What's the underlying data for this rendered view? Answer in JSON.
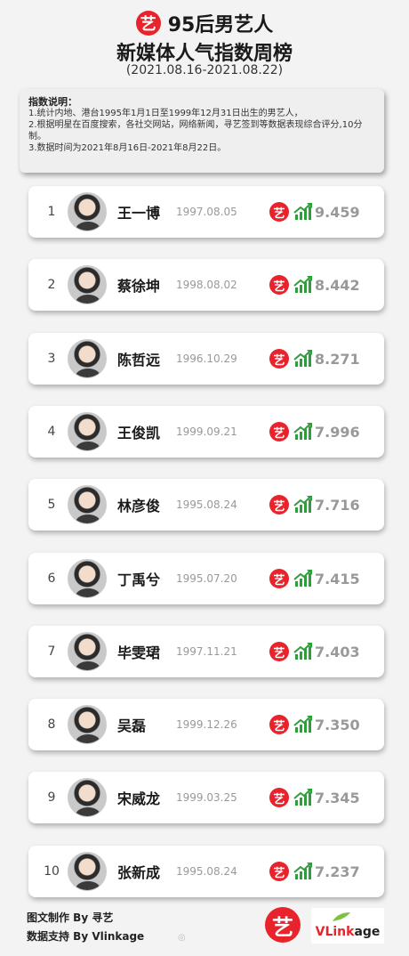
{
  "header": {
    "logo_char": "艺",
    "title1": "95后男艺人",
    "title2": "新媒体人气指数周榜",
    "date_range": "(2021.08.16-2021.08.22)"
  },
  "explanation": {
    "title": "指数说明：",
    "line1": "1.统计内地、港台1995年1月1日至1999年12月31日出生的男艺人，",
    "line2": "2.根据明星在百度搜索，各社交网站，网络新闻，寻艺签到等数据表现综合评分,10分制。",
    "line3": "3.数据时间为2021年8月16日-2021年8月22日。"
  },
  "rankings": [
    {
      "rank": "1",
      "name": "王一博",
      "birth": "1997.08.05",
      "score": "9.459"
    },
    {
      "rank": "2",
      "name": "蔡徐坤",
      "birth": "1998.08.02",
      "score": "8.442"
    },
    {
      "rank": "3",
      "name": "陈哲远",
      "birth": "1996.10.29",
      "score": "8.271"
    },
    {
      "rank": "4",
      "name": "王俊凯",
      "birth": "1999.09.21",
      "score": "7.996"
    },
    {
      "rank": "5",
      "name": "林彦俊",
      "birth": "1995.08.24",
      "score": "7.716"
    },
    {
      "rank": "6",
      "name": "丁禹兮",
      "birth": "1995.07.20",
      "score": "7.415"
    },
    {
      "rank": "7",
      "name": "毕雯珺",
      "birth": "1997.11.21",
      "score": "7.403"
    },
    {
      "rank": "8",
      "name": "吴磊",
      "birth": "1999.12.26",
      "score": "7.350"
    },
    {
      "rank": "9",
      "name": "宋威龙",
      "birth": "1999.03.25",
      "score": "7.345"
    },
    {
      "rank": "10",
      "name": "张新成",
      "birth": "1995.08.24",
      "score": "7.237"
    }
  ],
  "footer": {
    "credit1": "图文制作 By 寻艺",
    "credit2": "数据支持 By Vlinkage",
    "logo_char": "艺",
    "vlinkage_v": "V",
    "vlinkage_rest": "Link",
    "vlinkage_end": "age"
  },
  "colors": {
    "brand_red": "#e8232b",
    "trend_green": "#2e9e3a",
    "score_gray": "#999999"
  }
}
